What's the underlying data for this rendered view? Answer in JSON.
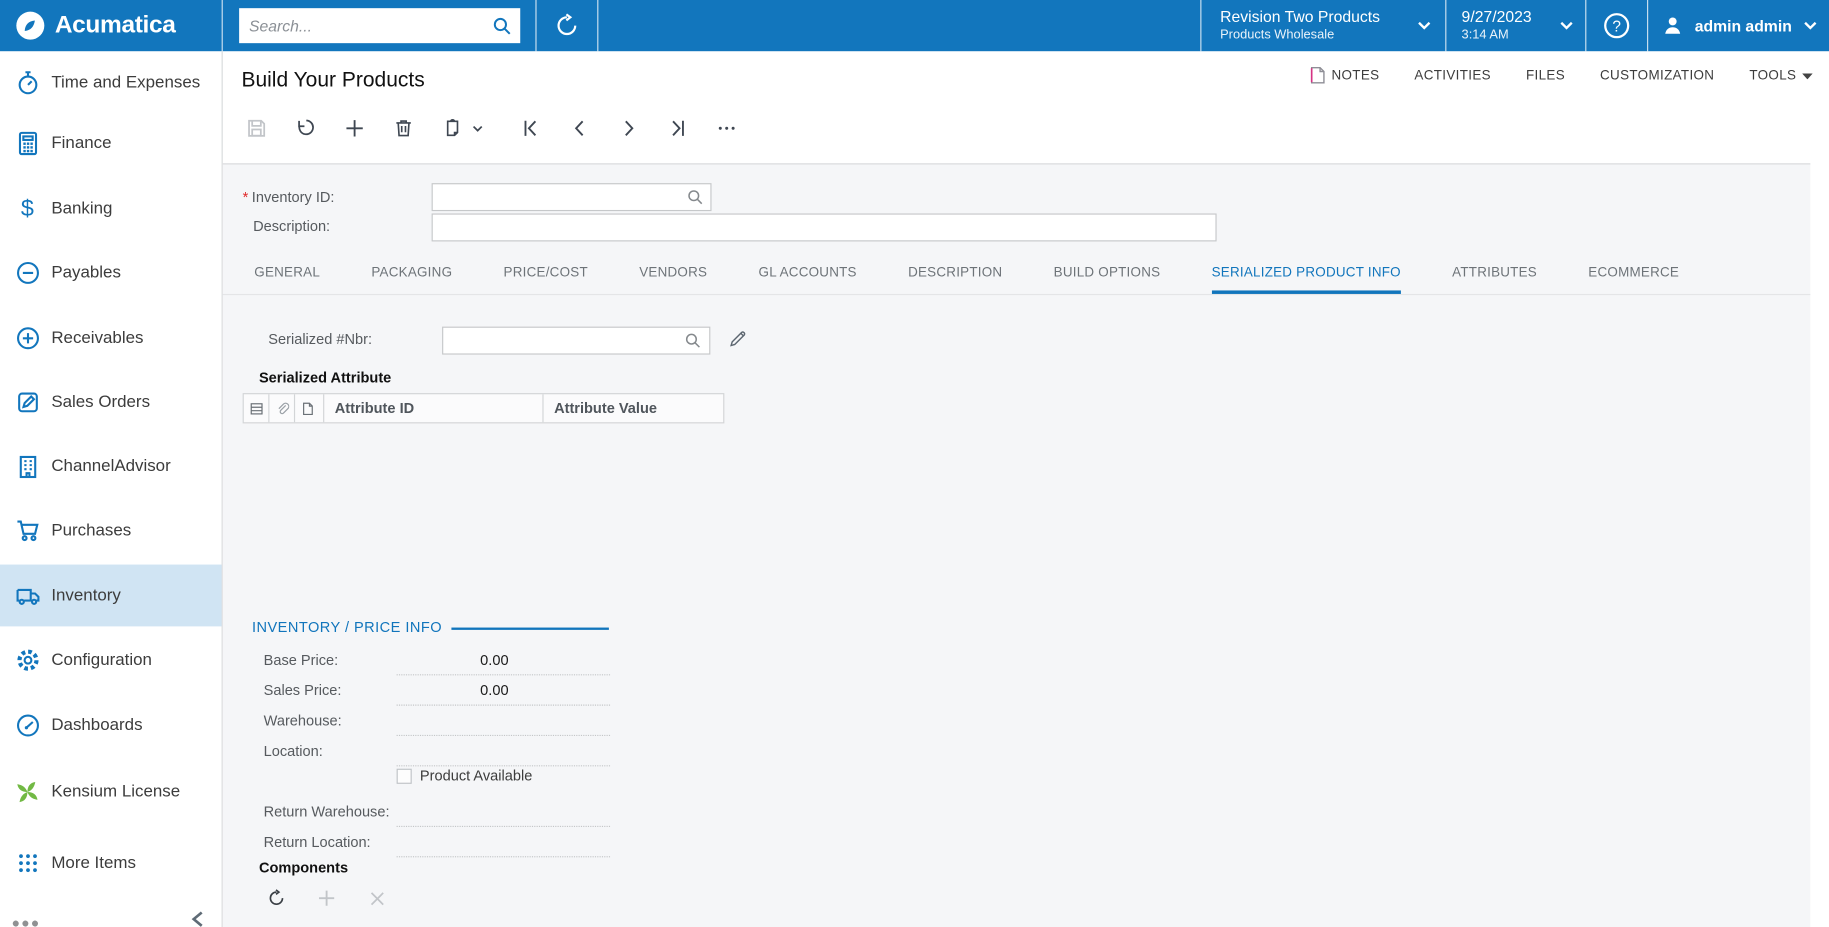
{
  "header": {
    "brand": "Acumatica",
    "search": {
      "placeholder": "Search..."
    },
    "company": {
      "name": "Revision Two Products",
      "branch": "Products Wholesale"
    },
    "business_date": {
      "date": "9/27/2023",
      "time": "3:14 AM"
    },
    "user": {
      "name": "admin admin"
    }
  },
  "sidebar": {
    "items": [
      {
        "label": "Time and Expenses",
        "icon": "stopwatch-icon"
      },
      {
        "label": "Finance",
        "icon": "calculator-icon"
      },
      {
        "label": "Banking",
        "icon": "dollar-icon"
      },
      {
        "label": "Payables",
        "icon": "minus-circle-icon"
      },
      {
        "label": "Receivables",
        "icon": "plus-circle-icon"
      },
      {
        "label": "Sales Orders",
        "icon": "pencil-square-icon"
      },
      {
        "label": "ChannelAdvisor",
        "icon": "building-icon"
      },
      {
        "label": "Purchases",
        "icon": "cart-icon"
      },
      {
        "label": "Inventory",
        "icon": "truck-icon",
        "selected": true
      },
      {
        "label": "Configuration",
        "icon": "gear-icon"
      },
      {
        "label": "Dashboards",
        "icon": "gauge-icon"
      },
      {
        "label": "Kensium License",
        "icon": "pinwheel-icon"
      },
      {
        "label": "More Items",
        "icon": "grid-dots-icon"
      }
    ]
  },
  "page": {
    "title": "Build Your Products",
    "header_links": [
      {
        "label": "NOTES",
        "icon": "note-icon"
      },
      {
        "label": "ACTIVITIES"
      },
      {
        "label": "FILES"
      },
      {
        "label": "CUSTOMIZATION"
      },
      {
        "label": "TOOLS",
        "icon": "caret-down-icon"
      }
    ],
    "toolbar": [
      "save",
      "undo",
      "add",
      "delete",
      "copy",
      "first",
      "previous",
      "next",
      "last",
      "more"
    ]
  },
  "form": {
    "inventory_id": {
      "label": "Inventory ID:",
      "required": "*",
      "value": ""
    },
    "description": {
      "label": "Description:",
      "value": ""
    }
  },
  "tabs": [
    "GENERAL",
    "PACKAGING",
    "PRICE/COST",
    "VENDORS",
    "GL ACCOUNTS",
    "DESCRIPTION",
    "BUILD OPTIONS",
    "SERIALIZED PRODUCT INFO",
    "ATTRIBUTES",
    "ECOMMERCE"
  ],
  "active_tab": "SERIALIZED PRODUCT INFO",
  "serialized_tab": {
    "nbr": {
      "label": "Serialized #Nbr:",
      "value": ""
    },
    "grid": {
      "title": "Serialized Attribute",
      "columns": [
        "Attribute ID",
        "Attribute Value"
      ],
      "rows": []
    },
    "price_info": {
      "title": "INVENTORY / PRICE INFO",
      "fields": [
        {
          "label": "Base Price:",
          "value": "0.00"
        },
        {
          "label": "Sales Price:",
          "value": "0.00"
        },
        {
          "label": "Warehouse:",
          "value": ""
        },
        {
          "label": "Location:",
          "value": ""
        },
        {
          "label": "Return Warehouse:",
          "value": ""
        },
        {
          "label": "Return Location:",
          "value": ""
        }
      ],
      "checkbox": {
        "label": "Product Available",
        "checked": false
      }
    },
    "components": {
      "title": "Components",
      "toolbar": [
        "refresh",
        "add",
        "delete"
      ]
    }
  },
  "colors": {
    "brand_blue": "#1276bd",
    "accent_blue": "#1175bc",
    "selected_item_bg": "#d0e4f3",
    "kensium_green": "#72b944",
    "required_red": "#e02a2a",
    "panel_bg": "#f5f6f8"
  }
}
